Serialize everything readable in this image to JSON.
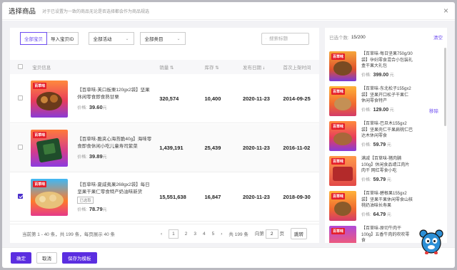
{
  "modal": {
    "title": "选择商品",
    "subtitle": "对于已设置为一致的商品无论是否选择都会作为商品规选",
    "close_glyph": "×"
  },
  "filters": {
    "tabs": [
      {
        "label": "全部宝贝",
        "active": true
      },
      {
        "label": "导入宝贝ID",
        "active": false
      }
    ],
    "activity_select": "全部活动",
    "category_select": "全部类目",
    "search_placeholder": "搜索标题"
  },
  "table": {
    "headers": {
      "product_info": "宝贝信息",
      "sales": "销量",
      "stock": "库存",
      "publish_date": "发布日期",
      "first_listed": "首次上架时间"
    },
    "price_label": "价格:",
    "currency": "元",
    "rows": [
      {
        "name": "【百草味-芙口板栗120gx2袋】坚果休闲零食即食熟甘栗",
        "price": "39.60",
        "sales": "320,574",
        "stock": "10,400",
        "publish_date": "2020-11-23",
        "first_listed": "2014-09-25",
        "checked": false,
        "tag": ""
      },
      {
        "name": "【百草味-脆夹心海苔脆40g】海味零食即食休闲小吃儿童寿司紫菜",
        "price": "39.89",
        "sales": "1,439,191",
        "stock": "25,439",
        "publish_date": "2020-11-23",
        "first_listed": "2016-11-02",
        "checked": false,
        "tag": ""
      },
      {
        "name": "【百草味-夏威夷果268gx2袋】每日坚果干果仁零食特产奶油味新货",
        "price": "78.79",
        "sales": "15,551,638",
        "stock": "16,847",
        "publish_date": "2020-11-23",
        "first_listed": "2018-09-30",
        "checked": true,
        "tag": "已选取"
      }
    ]
  },
  "pagination": {
    "summary": "当前第 1 - 40 条，共 199 条，每页展示 40 条",
    "prev": "‹",
    "pages": [
      "1",
      "2",
      "3",
      "4",
      "5"
    ],
    "next": "›",
    "total": "共 199 条",
    "goto_prefix": "向第",
    "goto_value": "2",
    "goto_suffix": "页",
    "goto_button": "跳转"
  },
  "selected_panel": {
    "label": "已选个数:",
    "count": "15/200",
    "clear": "清空",
    "remove": "移除",
    "price_label": "价格:",
    "currency": "元",
    "items": [
      {
        "name": "【百草味-每日坚果750g/30袋】孕妇零食混合小包装礼盒干果大礼包",
        "price": "399.00"
      },
      {
        "name": "【百草味-东北松子155gx2袋】坚果开口松子干果仁 休闲零食特产",
        "price": "129.00"
      },
      {
        "name": "【百草味-巴旦木155gx2袋】坚果壳仁干果扁桃仁巴达木休闲零食",
        "price": "59.79"
      },
      {
        "name": "满减【百草味-猪肉脯100g】休闲食品靖江肉片肉干 网红零食小吃",
        "price": "59.79"
      },
      {
        "name": "【百草味-碧根果155gx2袋】坚果干果休闲零食山核桃奶油味长寿果",
        "price": "64.79"
      },
      {
        "name": "【百草味-原切牛肉干100g】五香牛肉的吹吹零食",
        "price": ""
      }
    ]
  },
  "footer": {
    "confirm": "确定",
    "cancel": "取消",
    "save_template": "保存为模板"
  },
  "colors": {
    "accent": "#6d4cf0",
    "primary_button": "#5b2ee0",
    "checkbox_on": "#4a2ecb"
  }
}
